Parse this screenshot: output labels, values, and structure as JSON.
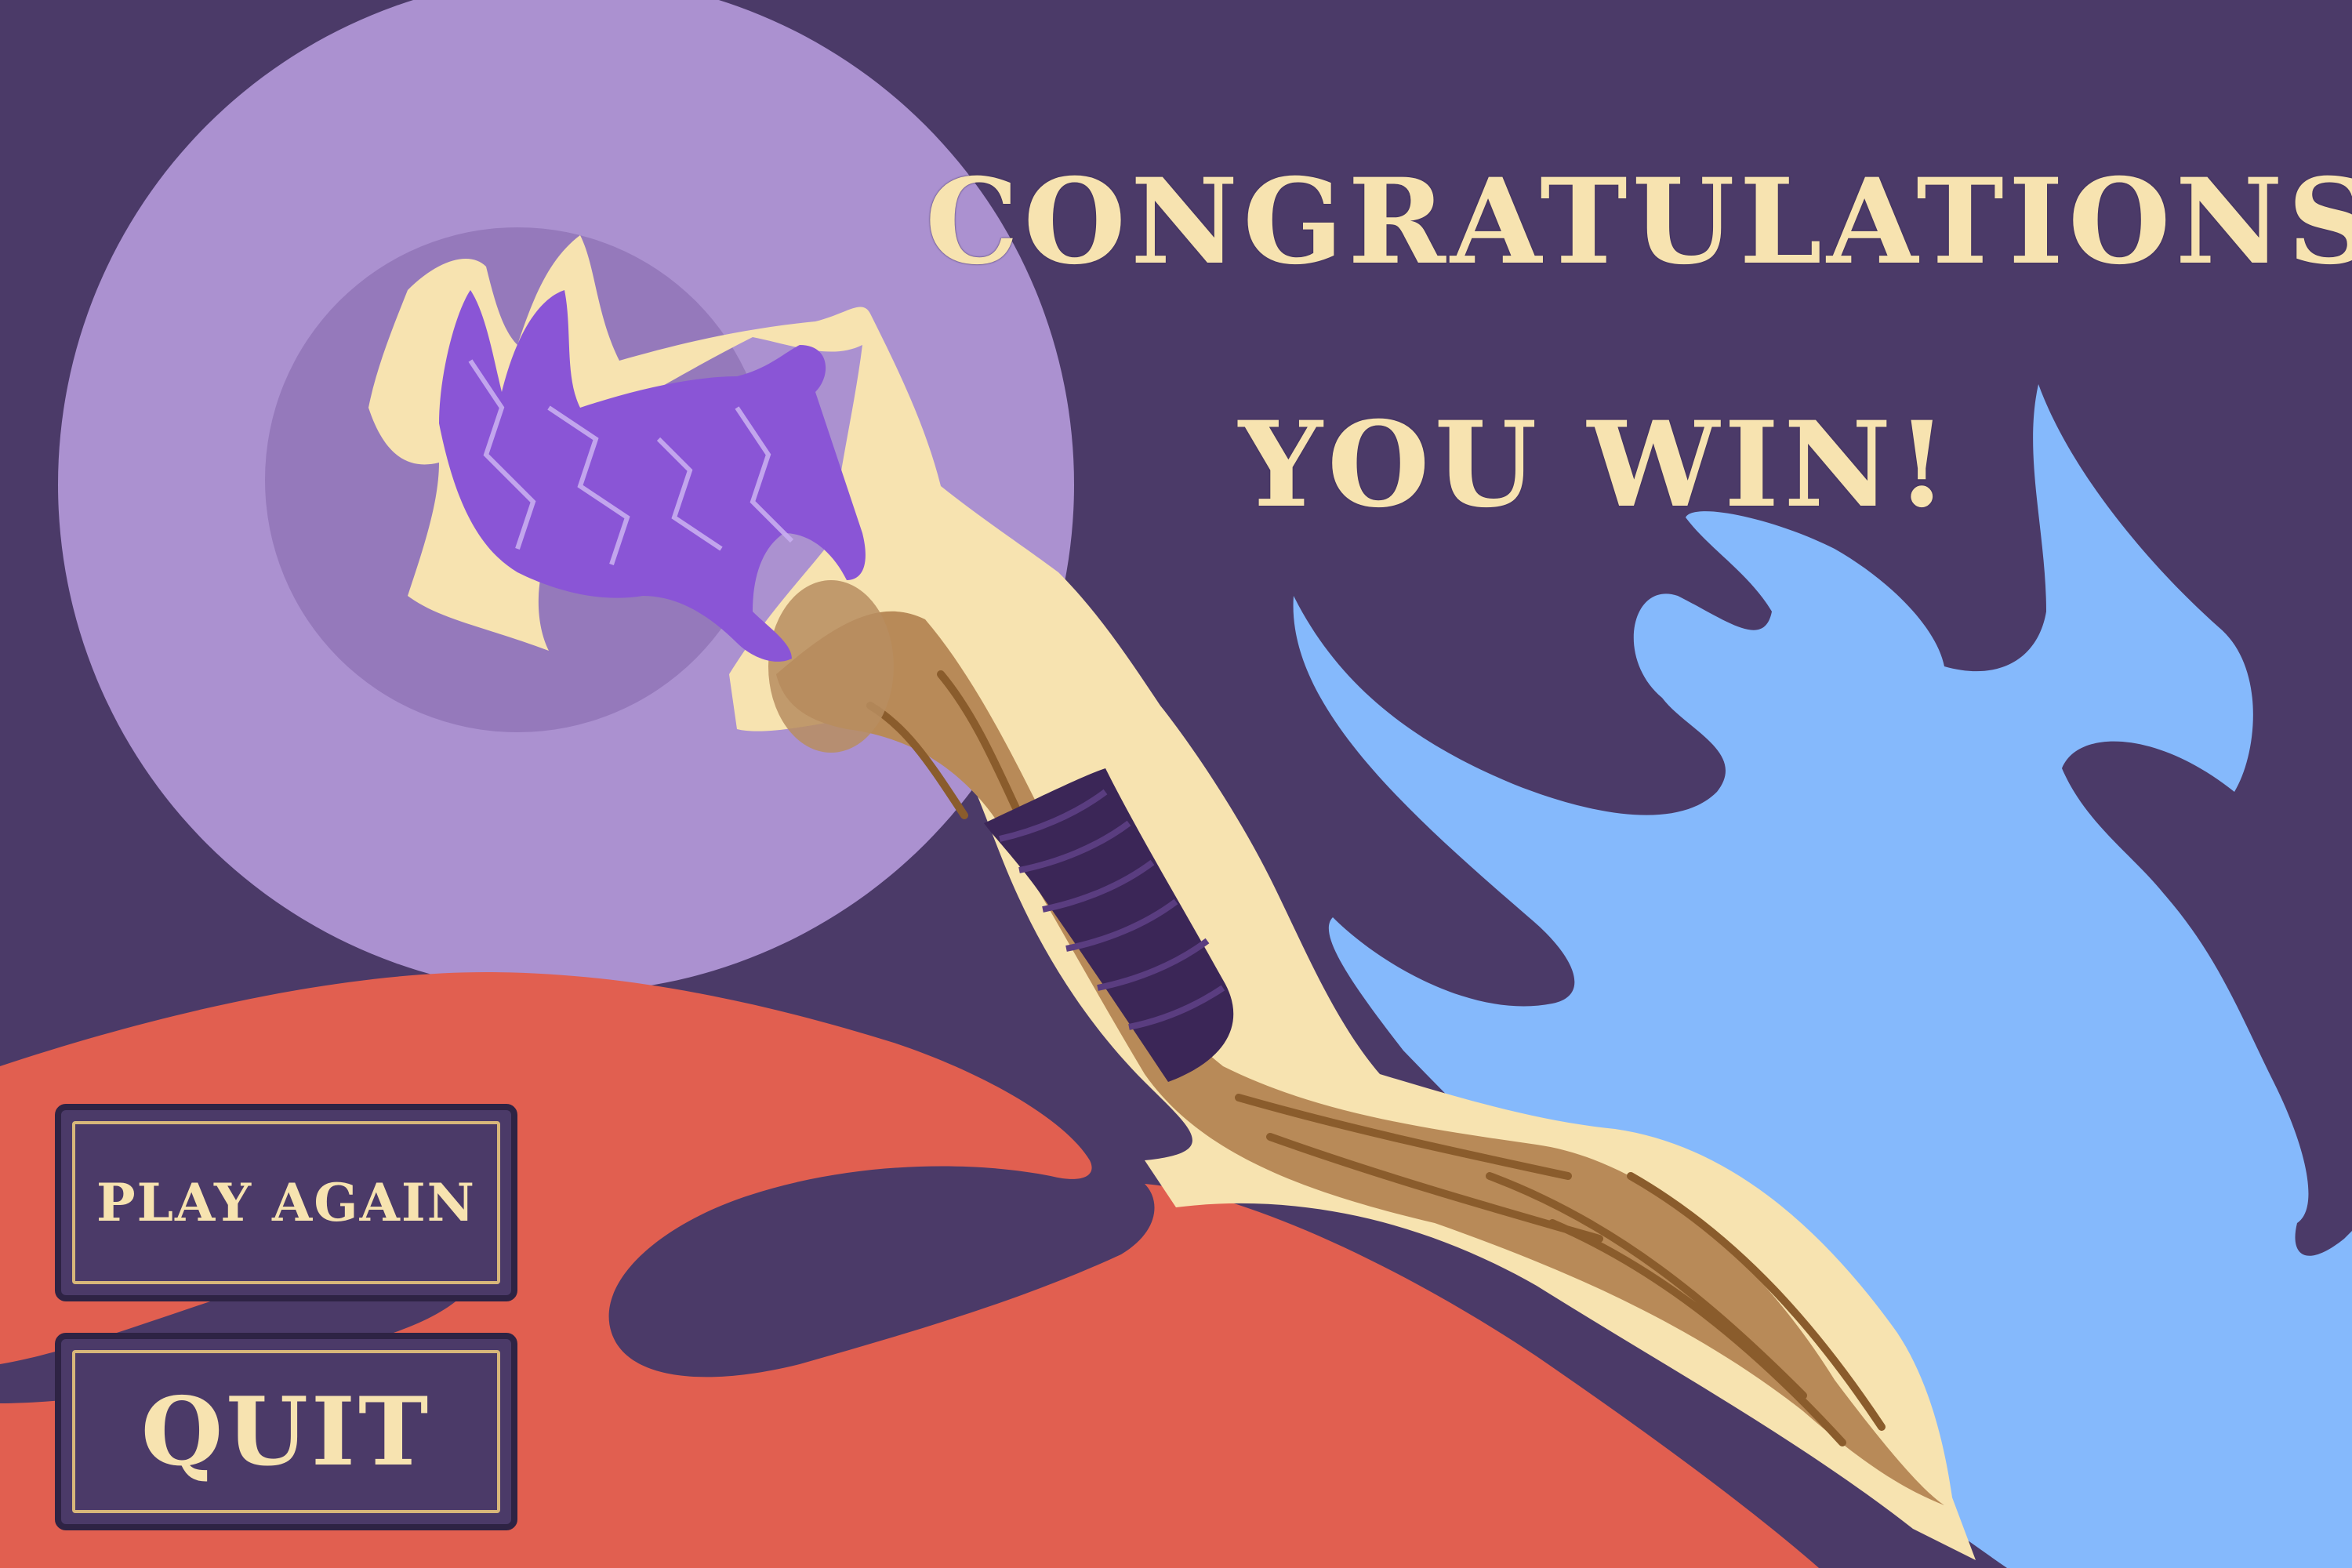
{
  "screen": {
    "title_line_1": "CONGRATULATIONS",
    "title_line_2": "YOU WIN!"
  },
  "menu": {
    "play_again_label": "PLAY AGAIN",
    "quit_label": "QUIT"
  },
  "colors": {
    "background": "#4b3a68",
    "moon_outer": "#ab91d0",
    "moon_inner": "#9579bb",
    "red_hill": "#e15f50",
    "blue_flame": "#85b9fc",
    "cream": "#f7e3b0",
    "wood": "#b88a58",
    "wrap": "#3b2657",
    "crystal": "#8a55d6"
  }
}
